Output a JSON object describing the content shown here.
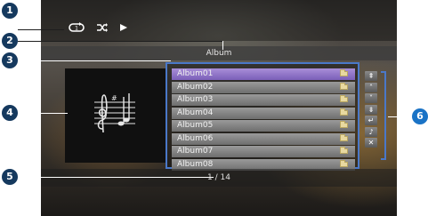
{
  "header": {
    "title": "Album"
  },
  "status_icons": [
    "repeat-icon",
    "shuffle-icon",
    "play-icon"
  ],
  "list": {
    "items": [
      {
        "label": "Album01",
        "selected": true
      },
      {
        "label": "Album02",
        "selected": false
      },
      {
        "label": "Album03",
        "selected": false
      },
      {
        "label": "Album04",
        "selected": false
      },
      {
        "label": "Album05",
        "selected": false
      },
      {
        "label": "Album06",
        "selected": false
      },
      {
        "label": "Album07",
        "selected": false
      },
      {
        "label": "Album08",
        "selected": false
      }
    ]
  },
  "controls": [
    {
      "name": "first-page-button",
      "glyph": "⇞"
    },
    {
      "name": "page-up-button",
      "glyph": "˄"
    },
    {
      "name": "page-down-button",
      "glyph": "˅"
    },
    {
      "name": "last-page-button",
      "glyph": "⇟"
    },
    {
      "name": "return-button",
      "glyph": "↵"
    },
    {
      "name": "now-playing-button",
      "glyph": "♪"
    },
    {
      "name": "close-button",
      "glyph": "✕"
    }
  ],
  "footer": {
    "page": "1 / 14"
  },
  "callouts": [
    "1",
    "2",
    "3",
    "4",
    "5",
    "6"
  ],
  "colors": {
    "highlight": "#7a5fb8",
    "frame": "#4a78c8",
    "badge": "#15395e",
    "badge_six": "#1a73c6"
  }
}
